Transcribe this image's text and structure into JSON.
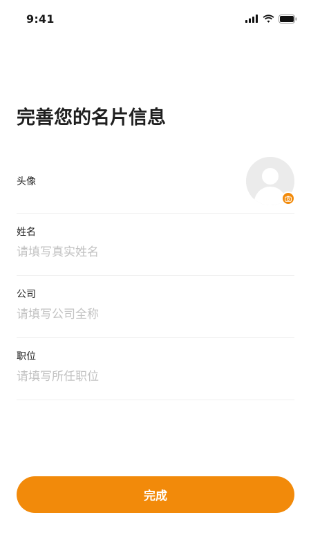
{
  "status_bar": {
    "time": "9:41",
    "icons": [
      "signal-icon",
      "wifi-icon",
      "battery-icon"
    ]
  },
  "title": "完善您的名片信息",
  "form": {
    "avatar": {
      "label": "头像",
      "icon": "avatar-placeholder-icon",
      "badge_icon": "camera-icon"
    },
    "fields": [
      {
        "label": "姓名",
        "value": "",
        "placeholder": "请填写真实姓名"
      },
      {
        "label": "公司",
        "value": "",
        "placeholder": "请填写公司全称"
      },
      {
        "label": "职位",
        "value": "",
        "placeholder": "请填写所任职位"
      }
    ]
  },
  "submit": {
    "label": "完成"
  },
  "colors": {
    "accent": "#f28a0a",
    "text": "#1a1a1a",
    "placeholder": "#c2c2c2",
    "divider": "#f0f0f0"
  }
}
